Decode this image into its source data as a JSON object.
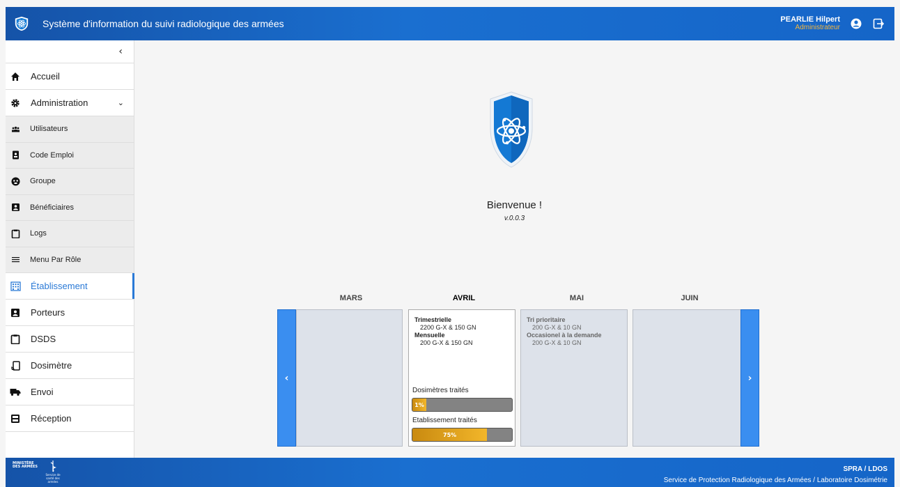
{
  "header": {
    "title": "Système d'information du suivi radiologique des armées",
    "user_name": "PEARLIE Hilpert",
    "user_role": "Administrateur"
  },
  "sidebar": {
    "items": [
      {
        "label": "Accueil",
        "icon": "home-icon"
      },
      {
        "label": "Administration",
        "icon": "gear-icon"
      },
      {
        "label": "Utilisateurs",
        "icon": "users-icon"
      },
      {
        "label": "Code Emploi",
        "icon": "id-card-icon"
      },
      {
        "label": "Groupe",
        "icon": "group-icon"
      },
      {
        "label": "Bénéficiaires",
        "icon": "beneficiary-icon"
      },
      {
        "label": "Logs",
        "icon": "clipboard-icon"
      },
      {
        "label": "Menu Par Rôle",
        "icon": "menu-icon"
      },
      {
        "label": "Établissement",
        "icon": "building-icon"
      },
      {
        "label": "Porteurs",
        "icon": "badge-icon"
      },
      {
        "label": "DSDS",
        "icon": "clipboard-icon"
      },
      {
        "label": "Dosimètre",
        "icon": "dosimeter-icon"
      },
      {
        "label": "Envoi",
        "icon": "truck-icon"
      },
      {
        "label": "Réception",
        "icon": "inbox-icon"
      }
    ]
  },
  "main": {
    "welcome": "Bienvenue !",
    "version": "v.0.0.3",
    "months": [
      "MARS",
      "AVRIL",
      "MAI",
      "JUIN"
    ],
    "current_card": {
      "line1_title": "Trimestrielle",
      "line1_value": "2200 G-X & 150 GN",
      "line2_title": "Mensuelle",
      "line2_value": "200 G-X & 150 GN",
      "progress1_label": "Dosimètres traités",
      "progress1_text": "1%",
      "progress1_value": 1,
      "progress2_label": "Etablissement traités",
      "progress2_text": "75%",
      "progress2_value": 75
    },
    "future_card": {
      "line1_title": "Tri prioritaire",
      "line1_value": "200 G-X & 10 GN",
      "line2_title": "Occasionel à la demande",
      "line2_value": "200 G-X & 10 GN"
    }
  },
  "footer": {
    "ministere": "MINISTÈRE DES ARMÉES",
    "ssa": "Service de santé des armées",
    "spra_short": "SPRA / LDOS",
    "spra_full": "Service de Protection Radiologique des Armées / Laboratoire Dosimétrie"
  }
}
